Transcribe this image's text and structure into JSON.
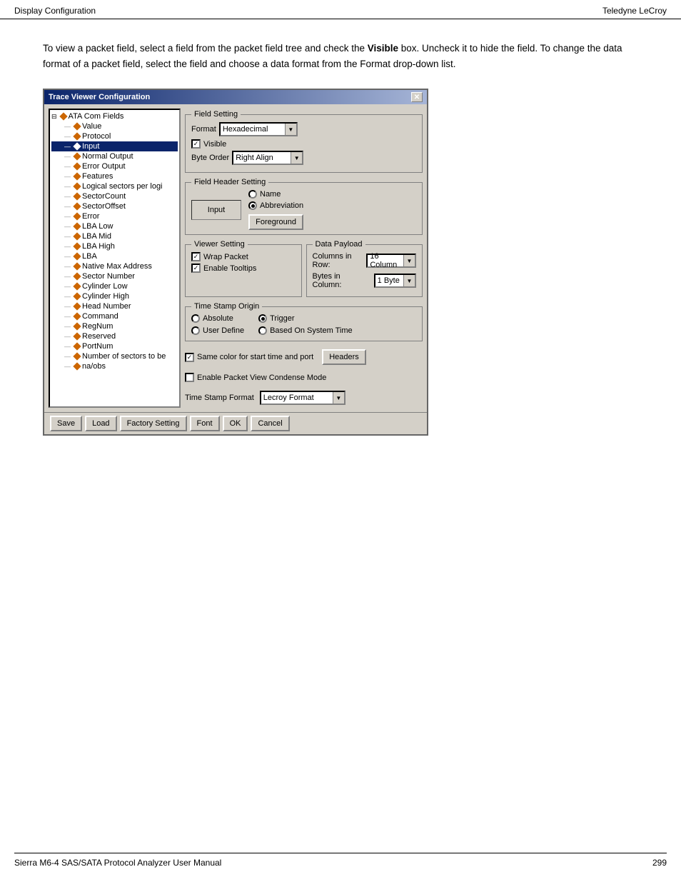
{
  "header": {
    "left": "Display Configuration",
    "right": "Teledyne LeCroy"
  },
  "footer": {
    "left": "Sierra M6-4 SAS/SATA Protocol Analyzer User Manual",
    "right": "299"
  },
  "intro": {
    "paragraph": "To view a packet field, select a field from the packet field tree and check the Visible box. Uncheck it to hide the field. To change the data format of a packet field, select the field and choose a data format from the Format drop-down list.",
    "bold_word": "Visible"
  },
  "dialog": {
    "title": "Trace Viewer Configuration",
    "close_btn": "✕",
    "tree": {
      "items": [
        {
          "label": "ATA Com Fields",
          "level": 0,
          "expand": "⊟",
          "diamond": true
        },
        {
          "label": "Value",
          "level": 1,
          "diamond": true
        },
        {
          "label": "Protocol",
          "level": 1,
          "diamond": true
        },
        {
          "label": "Input",
          "level": 1,
          "diamond": true,
          "selected": true
        },
        {
          "label": "Normal Output",
          "level": 1,
          "diamond": true
        },
        {
          "label": "Error Output",
          "level": 1,
          "diamond": true
        },
        {
          "label": "Features",
          "level": 1,
          "diamond": true
        },
        {
          "label": "Logical sectors per logi",
          "level": 1,
          "diamond": true
        },
        {
          "label": "SectorCount",
          "level": 1,
          "diamond": true
        },
        {
          "label": "SectorOffset",
          "level": 1,
          "diamond": true
        },
        {
          "label": "Error",
          "level": 1,
          "diamond": true
        },
        {
          "label": "LBA Low",
          "level": 1,
          "diamond": true
        },
        {
          "label": "LBA Mid",
          "level": 1,
          "diamond": true
        },
        {
          "label": "LBA High",
          "level": 1,
          "diamond": true
        },
        {
          "label": "LBA",
          "level": 1,
          "diamond": true
        },
        {
          "label": "Native Max Address",
          "level": 1,
          "diamond": true
        },
        {
          "label": "Sector Number",
          "level": 1,
          "diamond": true
        },
        {
          "label": "Cylinder Low",
          "level": 1,
          "diamond": true
        },
        {
          "label": "Cylinder High",
          "level": 1,
          "diamond": true
        },
        {
          "label": "Head Number",
          "level": 1,
          "diamond": true
        },
        {
          "label": "Command",
          "level": 1,
          "diamond": true
        },
        {
          "label": "RegNum",
          "level": 1,
          "diamond": true
        },
        {
          "label": "Reserved",
          "level": 1,
          "diamond": true
        },
        {
          "label": "PortNum",
          "level": 1,
          "diamond": true
        },
        {
          "label": "Number of sectors to be",
          "level": 1,
          "diamond": true
        },
        {
          "label": "na/obs",
          "level": 1,
          "diamond": true
        }
      ]
    },
    "field_setting": {
      "group_label": "Field Setting",
      "format_label": "Format",
      "format_value": "Hexadecimal",
      "visible_label": "Visible",
      "visible_checked": true,
      "byte_order_label": "Byte Order",
      "byte_order_value": "Right Align"
    },
    "field_header_setting": {
      "group_label": "Field Header Setting",
      "center_label": "Input",
      "radio_name": {
        "label": "Name",
        "selected": false
      },
      "radio_abbreviation": {
        "label": "Abbreviation",
        "selected": true
      },
      "foreground_btn": "Foreground"
    },
    "viewer_setting": {
      "group_label": "Viewer Setting",
      "wrap_packet_label": "Wrap Packet",
      "wrap_packet_checked": true,
      "enable_tooltips_label": "Enable Tooltips",
      "enable_tooltips_checked": true
    },
    "data_payload": {
      "group_label": "Data Payload",
      "columns_in_row_label": "Columns in Row:",
      "columns_in_row_value": "16 Column",
      "bytes_in_column_label": "Bytes in Column:",
      "bytes_in_column_value": "1 Byte"
    },
    "time_stamp_origin": {
      "group_label": "Time Stamp Origin",
      "absolute_label": "Absolute",
      "absolute_selected": false,
      "trigger_label": "Trigger",
      "trigger_selected": true,
      "user_define_label": "User Define",
      "user_define_selected": false,
      "based_on_system_label": "Based On System Time",
      "based_on_system_selected": false
    },
    "same_color_label": "Same color for start time and port",
    "same_color_checked": true,
    "headers_btn": "Headers",
    "enable_condense_label": "Enable Packet View Condense Mode",
    "enable_condense_checked": false,
    "time_stamp_format_label": "Time Stamp Format",
    "time_stamp_format_value": "Lecroy Format",
    "footer_buttons": {
      "save": "Save",
      "load": "Load",
      "factory_setting": "Factory Setting",
      "font": "Font",
      "ok": "OK",
      "cancel": "Cancel"
    }
  }
}
